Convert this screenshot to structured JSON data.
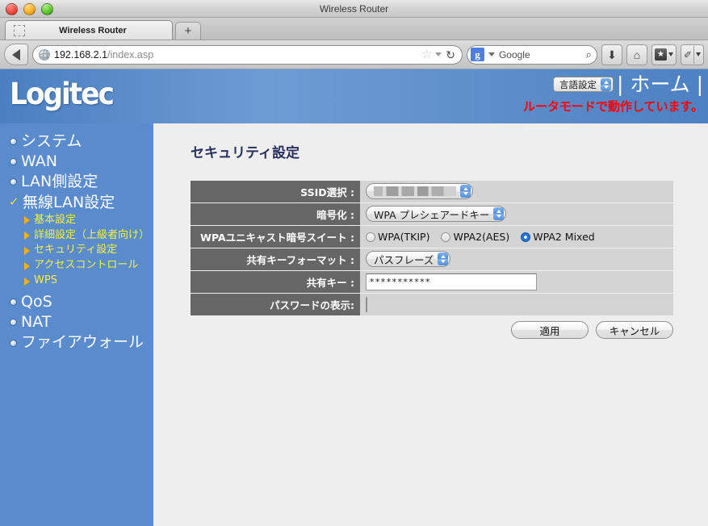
{
  "window": {
    "title": "Wireless Router"
  },
  "browser": {
    "tab": {
      "label": "Wireless Router"
    },
    "new_tab_label": "+",
    "back_icon": "back-arrow-icon",
    "url": {
      "host": "192.168.2.1",
      "path": "/index.asp"
    },
    "bookmark_icon": "star-icon",
    "reload_icon": "↻",
    "search": {
      "engine_badge": "g",
      "label": "Google",
      "magnifier": "⌕"
    },
    "toolbar_buttons": [
      {
        "name": "downloads-button",
        "glyph": "⬇"
      },
      {
        "name": "home-button",
        "glyph": "⌂"
      },
      {
        "name": "bookmarks-button",
        "glyph": "★"
      },
      {
        "name": "customize-button",
        "glyph": "✎"
      }
    ]
  },
  "router": {
    "logo_text": "Logitec",
    "language_select": {
      "label": "言語設定"
    },
    "home_link": "| ホーム |",
    "status_message": "ルータモードで動作しています。",
    "status_color": "#ff0000"
  },
  "sidebar": {
    "items": [
      {
        "label": "システム",
        "marker": "bullet"
      },
      {
        "label": "WAN",
        "marker": "bullet"
      },
      {
        "label": "LAN側設定",
        "marker": "bullet"
      },
      {
        "label": "無線LAN設定",
        "marker": "check"
      }
    ],
    "sub_items": [
      {
        "label": "基本設定"
      },
      {
        "label": "詳細設定（上級者向け）"
      },
      {
        "label": "セキュリティ設定"
      },
      {
        "label": "アクセスコントロール"
      },
      {
        "label": "WPS"
      }
    ],
    "items_after": [
      {
        "label": "QoS",
        "marker": "bullet"
      },
      {
        "label": "NAT",
        "marker": "bullet"
      },
      {
        "label": "ファイアウォール",
        "marker": "bullet"
      }
    ]
  },
  "main": {
    "title": "セキュリティ設定",
    "fields": {
      "ssid": {
        "label": "SSID選択 :",
        "value": ""
      },
      "encryption": {
        "label": "暗号化 :",
        "value": "WPA プレシェアードキー"
      },
      "cipher_suite": {
        "label": "WPAユニキャスト暗号スイート :",
        "options": [
          {
            "label": "WPA(TKIP)",
            "selected": false
          },
          {
            "label": "WPA2(AES)",
            "selected": false
          },
          {
            "label": "WPA2 Mixed",
            "selected": true
          }
        ]
      },
      "key_format": {
        "label": "共有キーフォーマット :",
        "value": "パスフレーズ"
      },
      "shared_key": {
        "label": "共有キー :",
        "value": "***********"
      },
      "show_password": {
        "label": "パスワードの表示:",
        "checked": false
      }
    },
    "buttons": {
      "apply": "適用",
      "cancel": "キャンセル"
    }
  }
}
